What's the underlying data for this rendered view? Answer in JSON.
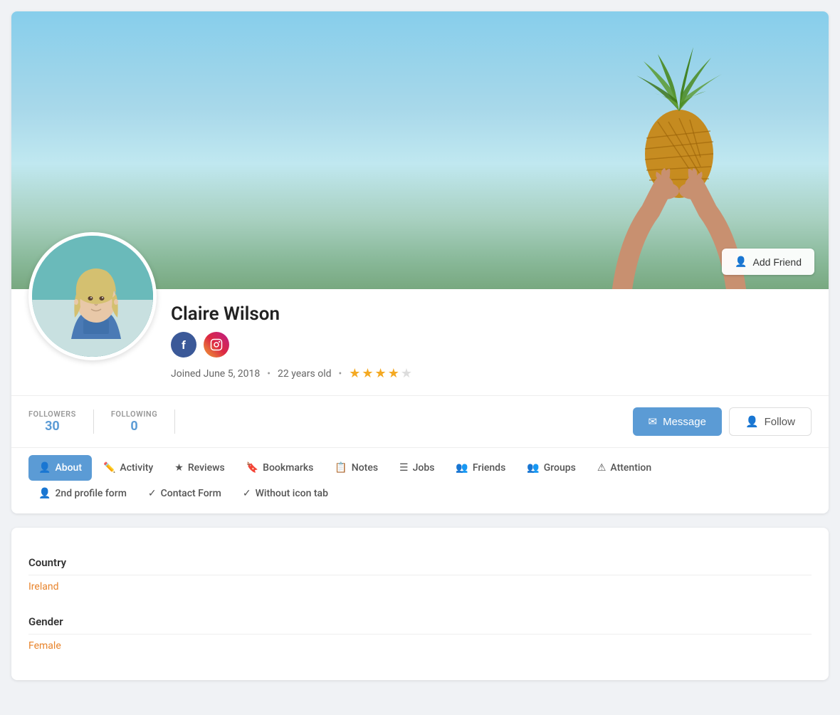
{
  "profile": {
    "name": "Claire Wilson",
    "joined": "Joined June 5, 2018",
    "age": "22 years old",
    "rating": 3.5,
    "country": "Ireland",
    "gender": "Female"
  },
  "stats": {
    "followers_label": "FOLLOWERS",
    "followers_count": "30",
    "following_label": "FOLLOWING",
    "following_count": "0"
  },
  "buttons": {
    "add_friend": "Add Friend",
    "message": "Message",
    "follow": "Follow"
  },
  "tabs": {
    "row1": [
      {
        "id": "about",
        "label": "About",
        "icon": "👤",
        "active": true
      },
      {
        "id": "activity",
        "label": "Activity",
        "icon": "✏️"
      },
      {
        "id": "reviews",
        "label": "Reviews",
        "icon": "★"
      },
      {
        "id": "bookmarks",
        "label": "Bookmarks",
        "icon": "🔖"
      },
      {
        "id": "notes",
        "label": "Notes",
        "icon": "📋"
      },
      {
        "id": "jobs",
        "label": "Jobs",
        "icon": "≡"
      },
      {
        "id": "friends",
        "label": "Friends",
        "icon": "👥"
      },
      {
        "id": "groups",
        "label": "Groups",
        "icon": "👥"
      },
      {
        "id": "attention",
        "label": "Attention",
        "icon": "⚠"
      }
    ],
    "row2": [
      {
        "id": "2nd-profile",
        "label": "2nd profile form",
        "icon": "👤"
      },
      {
        "id": "contact-form",
        "label": "Contact Form",
        "icon": "✓"
      },
      {
        "id": "without-icon",
        "label": "Without icon tab",
        "icon": "✓"
      }
    ]
  },
  "content": {
    "country_label": "Country",
    "country_value": "Ireland",
    "gender_label": "Gender",
    "gender_value": "Female"
  },
  "social": {
    "facebook_label": "f",
    "instagram_label": "ig"
  }
}
